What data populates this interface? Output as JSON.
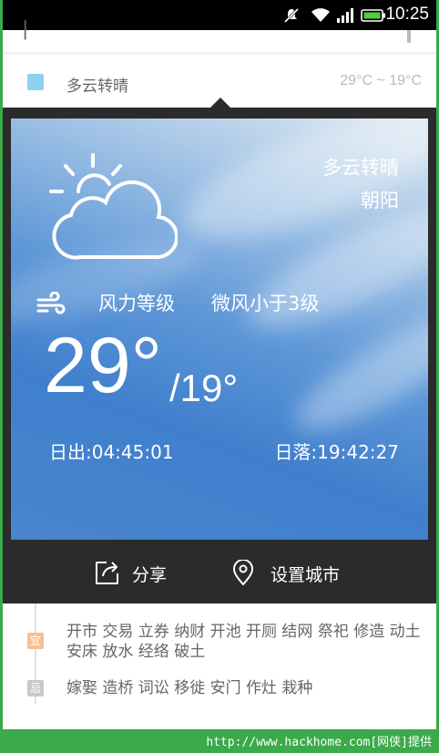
{
  "status_bar": {
    "time": "10:25"
  },
  "background_row": {
    "condition": "多云转晴",
    "temp_range": "29°C ~ 19°C"
  },
  "weather_card": {
    "condition": "多云转晴",
    "city": "朝阳",
    "wind_label": "风力等级",
    "wind_value": "微风小于3级",
    "temp_high": "29°",
    "temp_low": "/19°",
    "sunrise": "日出:04:45:01",
    "sunset": "日落:19:42:27"
  },
  "actions": {
    "share": "分享",
    "set_city": "设置城市"
  },
  "almanac": {
    "yi_badge": "宜",
    "yi_text": "开市 交易 立券 纳财 开池 开厕 结网 祭祀 修造 动土 安床 放水 经络 破土",
    "ji_badge": "忌",
    "ji_text": "嫁娶 造桥 词讼 移徙 安门 作灶 栽种"
  },
  "footer": {
    "credit": "http://www.hackhome.com[网侠]提供"
  }
}
